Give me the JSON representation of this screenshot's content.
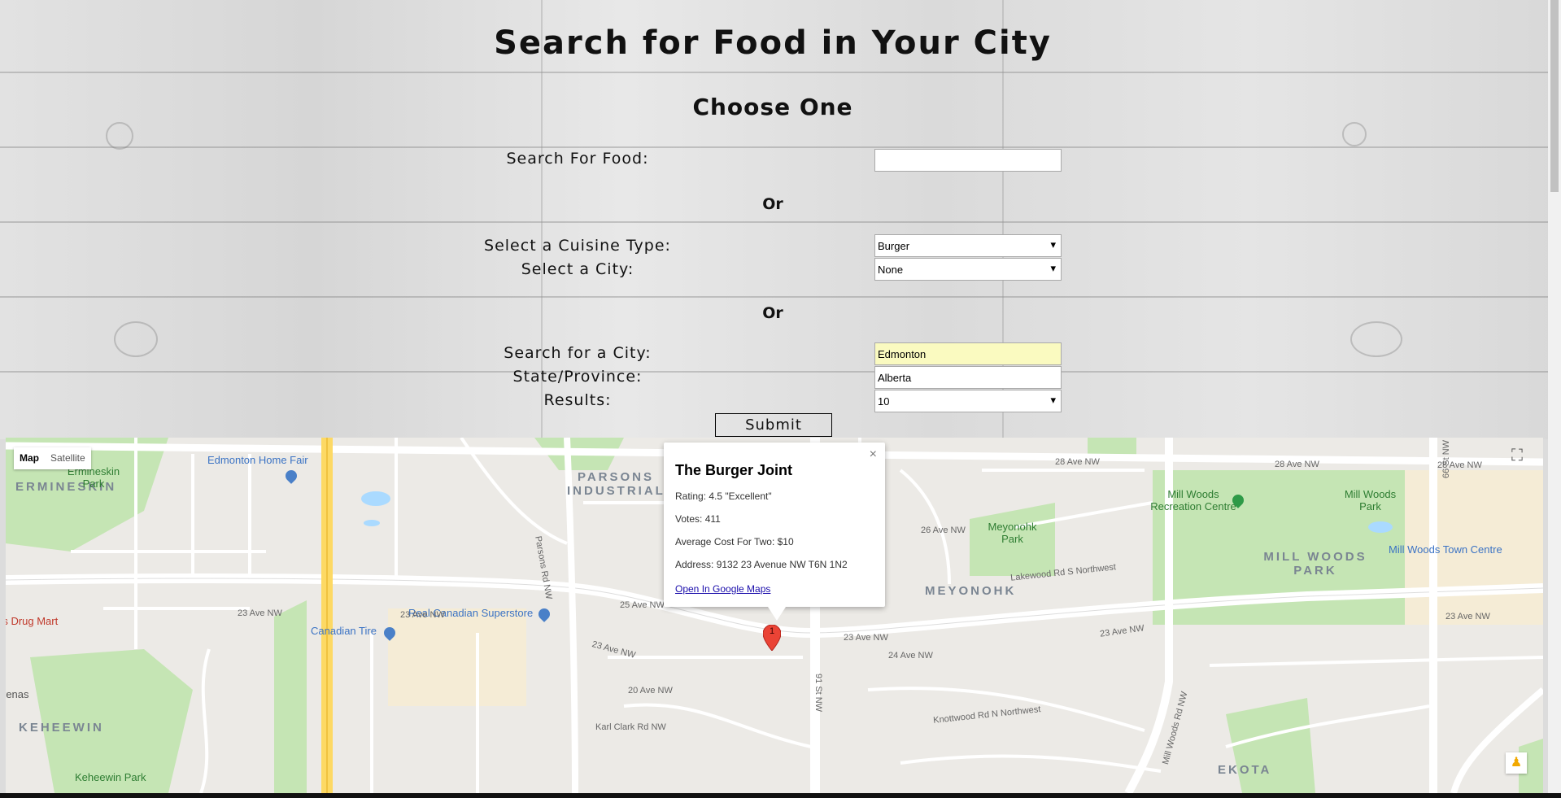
{
  "page": {
    "title": "Search for Food in Your City",
    "subtitle": "Choose One",
    "or_label_1": "Or",
    "or_label_2": "Or"
  },
  "form": {
    "food_label": "Search For Food:",
    "food_value": "",
    "cuisine_label": "Select a Cuisine Type:",
    "cuisine_value": "Burger",
    "city_select_label": "Select a City:",
    "city_select_value": "None",
    "city_search_label": "Search for a City:",
    "city_search_value": "Edmonton",
    "state_label": "State/Province:",
    "state_value": "Alberta",
    "results_label": "Results:",
    "results_value": "10",
    "submit_label": "Submit"
  },
  "map": {
    "type_map": "Map",
    "type_satellite": "Satellite",
    "districts": [
      "ERMINESKIN",
      "PARSONS INDUSTRIAL",
      "MEYONOHK",
      "MILL WOODS PARK",
      "KEHEEWIN",
      "EKOTA"
    ],
    "pois": {
      "home_fair": "Edmonton Home Fair",
      "rec_centre": "Mill Woods Recreation Centre",
      "park": "Mill Woods Park",
      "town_centre": "Mill Woods Town Centre",
      "ermineskin_park": "Ermineskin Park",
      "meyonohk_park": "Meyonohk Park",
      "superstore": "Real Canadian Superstore",
      "canadian_tire": "Canadian Tire",
      "keheewin_park": "Keheewin Park",
      "drug_mart": "rs Drug Mart",
      "arenas": "renas"
    },
    "streets": {
      "s1": "28 Ave NW",
      "s2": "28 Ave NW",
      "s3": "28 Ave NW",
      "s4": "23 Ave NW",
      "s5": "23 Ave NW",
      "s6": "23 Ave NW",
      "s7": "23 Ave NW",
      "s8": "23 Ave NW",
      "s9": "23 Ave NW",
      "s10": "Parsons Rd NW",
      "s11": "91 St NW",
      "s12": "66 St NW",
      "s13": "Mill Woods Rd NW",
      "s14": "24 Ave NW",
      "s15": "25 Ave NW",
      "s16": "Lakewood Rd S Northwest",
      "s17": "Karl Clark Rd NW",
      "s18": "Knottwood Rd N Northwest",
      "s19": "26 Ave NW",
      "s20": "20 Ave NW"
    },
    "marker_label": "1"
  },
  "info_window": {
    "title": "The Burger Joint",
    "rating": "Rating: 4.5 \"Excellent\"",
    "votes": "Votes: 411",
    "cost": "Average Cost For Two: $10",
    "address": "Address: 9132 23 Avenue NW T6N 1N2",
    "link": "Open In Google Maps",
    "close": "×"
  },
  "colors": {
    "park_green": "#c5e5b4",
    "road_yellow": "#fdd964",
    "road_white": "#ffffff",
    "marker_red": "#ea4335"
  }
}
